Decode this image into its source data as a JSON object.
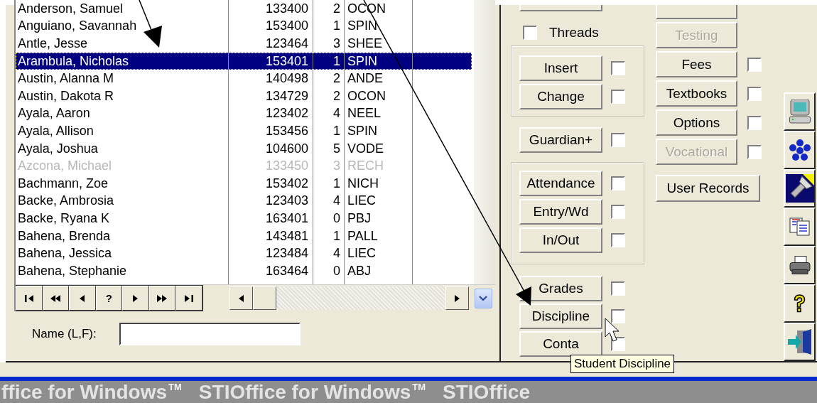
{
  "table": {
    "rows": [
      {
        "name": "Anderson, Samuel",
        "id": "133400",
        "grade": "2",
        "homeroom": "OCON",
        "selected": false,
        "inactive": false
      },
      {
        "name": "Anguiano, Savannah",
        "id": "153400",
        "grade": "1",
        "homeroom": "SPIN",
        "selected": false,
        "inactive": false
      },
      {
        "name": "Antle, Jesse",
        "id": "123464",
        "grade": "3",
        "homeroom": "SHEE",
        "selected": false,
        "inactive": false
      },
      {
        "name": "Arambula, Nicholas",
        "id": "153401",
        "grade": "1",
        "homeroom": "SPIN",
        "selected": true,
        "inactive": false
      },
      {
        "name": "Austin, Alanna M",
        "id": "140498",
        "grade": "2",
        "homeroom": "ANDE",
        "selected": false,
        "inactive": false
      },
      {
        "name": "Austin, Dakota R",
        "id": "134729",
        "grade": "2",
        "homeroom": "OCON",
        "selected": false,
        "inactive": false
      },
      {
        "name": "Ayala, Aaron",
        "id": "123402",
        "grade": "4",
        "homeroom": "NEEL",
        "selected": false,
        "inactive": false
      },
      {
        "name": "Ayala, Allison",
        "id": "153456",
        "grade": "1",
        "homeroom": "SPIN",
        "selected": false,
        "inactive": false
      },
      {
        "name": "Ayala, Joshua",
        "id": "104600",
        "grade": "5",
        "homeroom": "VODE",
        "selected": false,
        "inactive": false
      },
      {
        "name": "Azcona, Michael",
        "id": "133450",
        "grade": "3",
        "homeroom": "RECH",
        "selected": false,
        "inactive": true
      },
      {
        "name": "Bachmann, Zoe",
        "id": "153402",
        "grade": "1",
        "homeroom": "NICH",
        "selected": false,
        "inactive": false
      },
      {
        "name": "Backe, Ambrosia",
        "id": "123403",
        "grade": "4",
        "homeroom": "LIEC",
        "selected": false,
        "inactive": false
      },
      {
        "name": "Backe, Ryana K",
        "id": "163401",
        "grade": "0",
        "homeroom": "PBJ",
        "selected": false,
        "inactive": false
      },
      {
        "name": "Bahena, Brenda",
        "id": "143481",
        "grade": "1",
        "homeroom": "PALL",
        "selected": false,
        "inactive": false
      },
      {
        "name": "Bahena, Jessica",
        "id": "123484",
        "grade": "4",
        "homeroom": "LIEC",
        "selected": false,
        "inactive": false
      },
      {
        "name": "Bahena, Stephanie",
        "id": "163464",
        "grade": "0",
        "homeroom": "ABJ",
        "selected": false,
        "inactive": false
      }
    ]
  },
  "navigation": [
    {
      "kind": "first"
    },
    {
      "kind": "prev-page"
    },
    {
      "kind": "prev"
    },
    {
      "kind": "find",
      "label": "?"
    },
    {
      "kind": "next"
    },
    {
      "kind": "next-page"
    },
    {
      "kind": "last"
    }
  ],
  "name_field": {
    "label": "Name (L,F):"
  },
  "left_column": [
    {
      "kind": "clipped_button"
    },
    {
      "kind": "checkbox",
      "label": "Threads",
      "checked": false
    },
    {
      "kind": "group",
      "items": [
        {
          "label": "Insert",
          "checked": false
        },
        {
          "label": "Change",
          "checked": false
        }
      ]
    },
    {
      "kind": "button",
      "label": "Guardian+",
      "checked": false
    },
    {
      "kind": "group",
      "items": [
        {
          "label": "Attendance",
          "checked": false
        },
        {
          "label": "Entry/Wd",
          "checked": false
        },
        {
          "label": "In/Out",
          "checked": false
        }
      ]
    },
    {
      "kind": "stack",
      "items": [
        {
          "label": "Grades",
          "checked": false
        },
        {
          "label": "Discipline",
          "checked": false
        },
        {
          "label": "Conta",
          "checked": false
        }
      ]
    }
  ],
  "right_column": [
    {
      "kind": "clipped_button"
    },
    {
      "kind": "button",
      "label": "Testing",
      "disabled": true
    },
    {
      "kind": "button",
      "label": "Fees",
      "disabled": false,
      "checked": false
    },
    {
      "kind": "button",
      "label": "Textbooks",
      "disabled": false,
      "checked": false
    },
    {
      "kind": "button",
      "label": "Options",
      "disabled": false,
      "checked": false
    },
    {
      "kind": "button",
      "label": "Vocational",
      "disabled": true,
      "checked": false
    }
  ],
  "user_records": {
    "label": "User Records"
  },
  "toolbar": [
    {
      "kind": "computer"
    },
    {
      "kind": "asterisk"
    },
    {
      "kind": "flashlight"
    },
    {
      "kind": "documents"
    },
    {
      "kind": "printer"
    },
    {
      "kind": "help"
    },
    {
      "kind": "exit"
    }
  ],
  "tooltip": {
    "text": "Student Discipline"
  },
  "banner": {
    "text": "ffice for Windows",
    "mark": "TM",
    "text_2": "STIOffice for Windows",
    "mark_2": "TM",
    "text_3": "STIOffice"
  }
}
